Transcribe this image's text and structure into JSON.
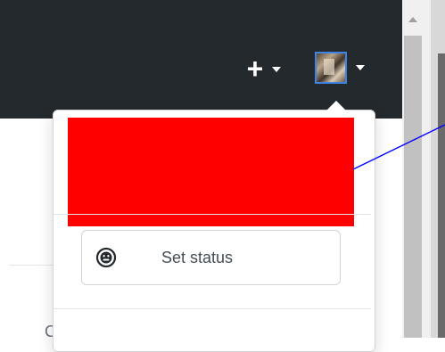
{
  "header": {
    "new_icon": "plus-icon",
    "avatar_icon": "user-avatar"
  },
  "menu": {
    "set_status_label": "Set status",
    "status_icon": "smiley-icon"
  },
  "colors": {
    "header_bg": "#24292e",
    "redaction": "#ff0000",
    "avatar_border": "#3d84e6",
    "annotation_line": "#0000ff"
  }
}
